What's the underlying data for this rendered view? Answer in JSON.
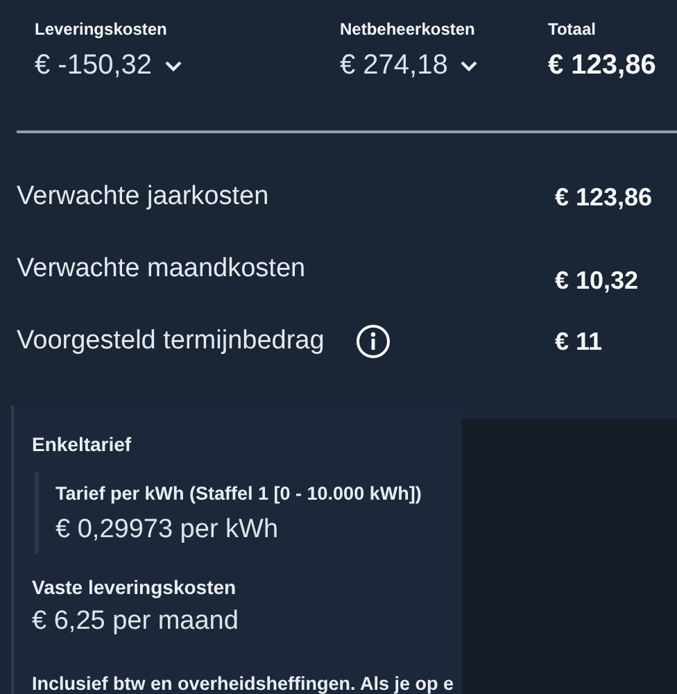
{
  "breakdown": [
    {
      "label": "Leveringskosten",
      "value": "€ -150,32",
      "kind": "dropdown"
    },
    {
      "label": "Netbeheerkosten",
      "value": "€ 274,18",
      "kind": "dropdown"
    },
    {
      "label": "Totaal",
      "value": "€ 123,86",
      "kind": "total"
    }
  ],
  "summary": [
    {
      "label": "Verwachte jaarkosten",
      "value": "€ 123,86",
      "info": false
    },
    {
      "label": "Verwachte maandkosten",
      "value": "€ 10,32",
      "info": false
    },
    {
      "label": "Voorgesteld termijnbedrag",
      "value": "€ 11",
      "info": true
    }
  ],
  "tooltip": {
    "title": "Enkeltarief",
    "tiers": [
      {
        "label": "Tarief per kWh (Staffel 1 [0 - 10.000 kWh])",
        "value": "€ 0,29973 per kWh"
      }
    ],
    "fixed_label": "Vaste leveringskosten",
    "fixed_value": "€ 6,25 per maand",
    "note": "Inclusief btw en overheidsheffingen. Als je op e"
  }
}
